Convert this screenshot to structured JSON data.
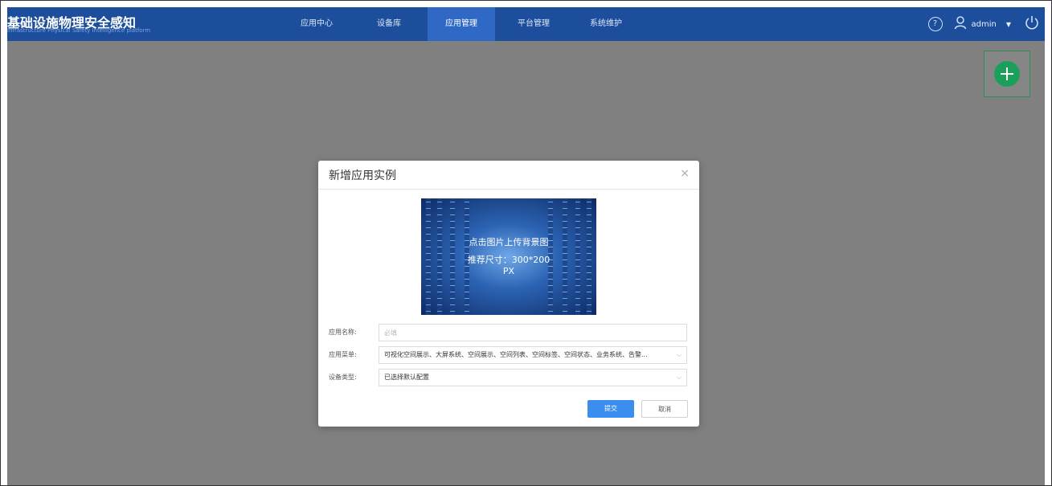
{
  "app": {
    "title": "基础设施物理安全感知",
    "subtitle": "Infrastructure Physical Safety Intelligence platform"
  },
  "nav": {
    "items": [
      {
        "label": "应用中心"
      },
      {
        "label": "设备库"
      },
      {
        "label": "应用管理",
        "active": true
      },
      {
        "label": "平台管理"
      },
      {
        "label": "系统维护"
      }
    ]
  },
  "header_tools": {
    "help_glyph": "?",
    "user": "admin",
    "caret": "▼"
  },
  "modal": {
    "title": "新增应用实例",
    "close": "×",
    "upload_line1": "点击图片上传背景图",
    "upload_line2": "推荐尺寸：300*200",
    "upload_line3": "PX",
    "fields": {
      "name_label": "应用名称:",
      "name_placeholder": "必填",
      "menu_label": "应用菜单:",
      "menu_value": "可视化空间展示、大屏系统、空间展示、空间列表、空间标签、空间状态、业务系统、告警...",
      "device_label": "设备类型:",
      "device_value": "已选择默认配置"
    },
    "submit": "提交",
    "cancel": "取消"
  },
  "icons": {
    "help": "help-circle-icon",
    "user": "user-icon",
    "power": "power-icon",
    "add": "plus-circle-icon",
    "close": "close-icon",
    "dropdown": "chevron-down-icon"
  },
  "colors": {
    "header_bg": "#1d4e9c",
    "nav_active": "#2f69c5",
    "overlay": "#808080",
    "add_green": "#1aa05a",
    "primary_button": "#3b8ef0"
  }
}
